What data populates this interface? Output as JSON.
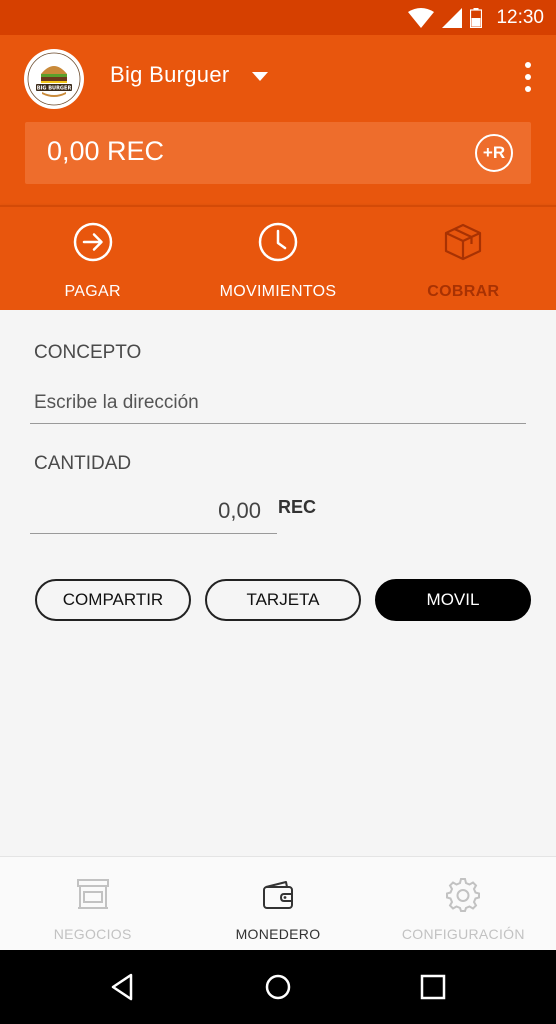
{
  "status_bar": {
    "time": "12:30",
    "icons": [
      "wifi-icon",
      "cell-signal-icon",
      "battery-icon"
    ]
  },
  "header": {
    "business_name": "Big Burguer",
    "avatar_logo_text": "BIG BURGER",
    "balance": "0,00 REC",
    "recharge_label": "+R",
    "menu_icon": "more-vert-icon"
  },
  "actions": [
    {
      "label": "PAGAR",
      "icon": "arrow-right-circle-icon"
    },
    {
      "label": "MOVIMIENTOS",
      "icon": "clock-icon"
    },
    {
      "label": "COBRAR",
      "icon": "box-icon",
      "active": true
    }
  ],
  "form": {
    "concept_label": "CONCEPTO",
    "concept_placeholder": "Escribe la dirección",
    "amount_label": "CANTIDAD",
    "amount_value": "0,00",
    "amount_unit": "REC",
    "buttons": [
      {
        "label": "COMPARTIR",
        "style": "outline"
      },
      {
        "label": "TARJETA",
        "style": "outline"
      },
      {
        "label": "MOVIL",
        "style": "filled"
      }
    ]
  },
  "bottom_nav": [
    {
      "label": "NEGOCIOS",
      "icon": "store-icon",
      "active": false
    },
    {
      "label": "MONEDERO",
      "icon": "wallet-icon",
      "active": true
    },
    {
      "label": "CONFIGURACIÓN",
      "icon": "gear-icon",
      "active": false
    }
  ],
  "system_nav": [
    "back-icon",
    "home-icon",
    "recents-icon"
  ],
  "colors": {
    "primary": "#e8560d",
    "status_bar": "#d64000",
    "balance_bg": "#ee6d2c",
    "active_action": "#a83203",
    "background": "#f5f5f5"
  }
}
